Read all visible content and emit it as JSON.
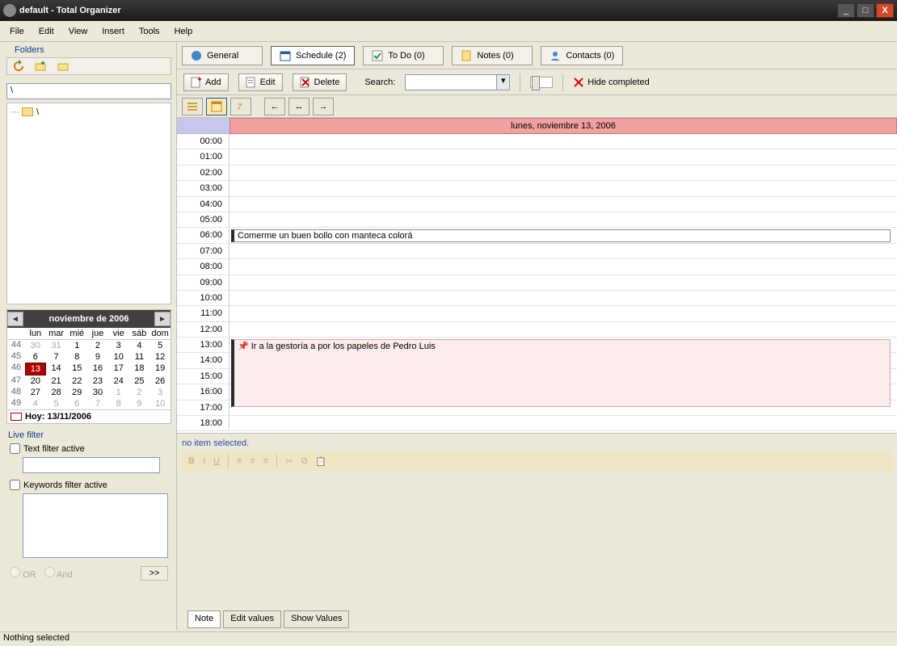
{
  "window": {
    "title": "default - Total Organizer"
  },
  "menu": [
    "File",
    "Edit",
    "View",
    "Insert",
    "Tools",
    "Help"
  ],
  "folders": {
    "header": "Folders",
    "path": "\\",
    "root": "\\"
  },
  "calendar": {
    "header": "noviembre de 2006",
    "dow": [
      "lun",
      "mar",
      "mié",
      "jue",
      "vie",
      "sáb",
      "dom"
    ],
    "weeks": [
      "44",
      "45",
      "46",
      "47",
      "48",
      "49"
    ],
    "grid": [
      [
        "30",
        "31",
        "1",
        "2",
        "3",
        "4",
        "5"
      ],
      [
        "6",
        "7",
        "8",
        "9",
        "10",
        "11",
        "12"
      ],
      [
        "13",
        "14",
        "15",
        "16",
        "17",
        "18",
        "19"
      ],
      [
        "20",
        "21",
        "22",
        "23",
        "24",
        "25",
        "26"
      ],
      [
        "27",
        "28",
        "29",
        "30",
        "1",
        "2",
        "3"
      ],
      [
        "4",
        "5",
        "6",
        "7",
        "8",
        "9",
        "10"
      ]
    ],
    "today_label": "Hoy: 13/11/2006"
  },
  "livefilter": {
    "header": "Live filter",
    "text_active": "Text filter active",
    "keywords_active": "Keywords filter active",
    "or": "OR",
    "and": "And",
    "go": ">>"
  },
  "tabs": {
    "general": "General",
    "schedule": "Schedule (2)",
    "todo": "To Do (0)",
    "notes": "Notes (0)",
    "contacts": "Contacts (0)"
  },
  "toolbar": {
    "add": "Add",
    "edit": "Edit",
    "delete": "Delete",
    "search_label": "Search:",
    "hide_completed": "Hide completed"
  },
  "schedule": {
    "day_header": "lunes, noviembre 13, 2006",
    "hours": [
      "00:00",
      "01:00",
      "02:00",
      "03:00",
      "04:00",
      "05:00",
      "06:00",
      "07:00",
      "08:00",
      "09:00",
      "10:00",
      "11:00",
      "12:00",
      "13:00",
      "14:00",
      "15:00",
      "16:00",
      "17:00",
      "18:00"
    ],
    "event1": "Comerme un buen bollo con manteca colorá",
    "event2": "Ir a la gestoría a por los papeles de Pedro Luis"
  },
  "detail": {
    "no_item": "no item selected."
  },
  "bottom_tabs": {
    "note": "Note",
    "edit_values": "Edit values",
    "show_values": "Show Values"
  },
  "status": "Nothing selected"
}
